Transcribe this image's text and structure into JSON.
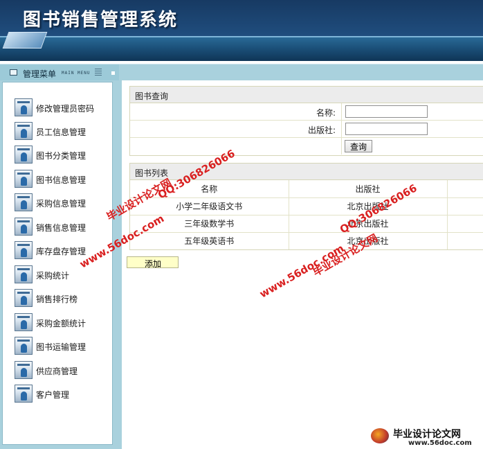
{
  "header": {
    "title": "图书销售管理系统"
  },
  "menubar": {
    "title": "管理菜单",
    "subtitle": "MAIN MENU"
  },
  "sidebar": {
    "items": [
      {
        "label": "修改管理员密码"
      },
      {
        "label": "员工信息管理"
      },
      {
        "label": "图书分类管理"
      },
      {
        "label": "图书信息管理"
      },
      {
        "label": "采购信息管理"
      },
      {
        "label": "销售信息管理"
      },
      {
        "label": "库存盘存管理"
      },
      {
        "label": "采购统计"
      },
      {
        "label": "销售排行榜"
      },
      {
        "label": "采购金额统计"
      },
      {
        "label": "图书运输管理"
      },
      {
        "label": "供应商管理"
      },
      {
        "label": "客户管理"
      }
    ]
  },
  "query": {
    "title": "图书查询",
    "name_label": "名称:",
    "name_value": "",
    "publisher_label": "出版社:",
    "publisher_value": "",
    "search_button": "查询"
  },
  "list": {
    "title": "图书列表",
    "columns": [
      "名称",
      "出版社",
      ""
    ],
    "rows": [
      [
        "小学二年级语文书",
        "北京出版社",
        ""
      ],
      [
        "三年级数学书",
        "北京出版社",
        ""
      ],
      [
        "五年级英语书",
        "北京出版社",
        ""
      ]
    ]
  },
  "actions": {
    "add_button": "添加"
  },
  "watermarks": {
    "site_cn": "毕业设计论文网",
    "qq": "QQ:306826066",
    "url": "www.56doc.com",
    "brand_url": "www.56doc.com"
  }
}
